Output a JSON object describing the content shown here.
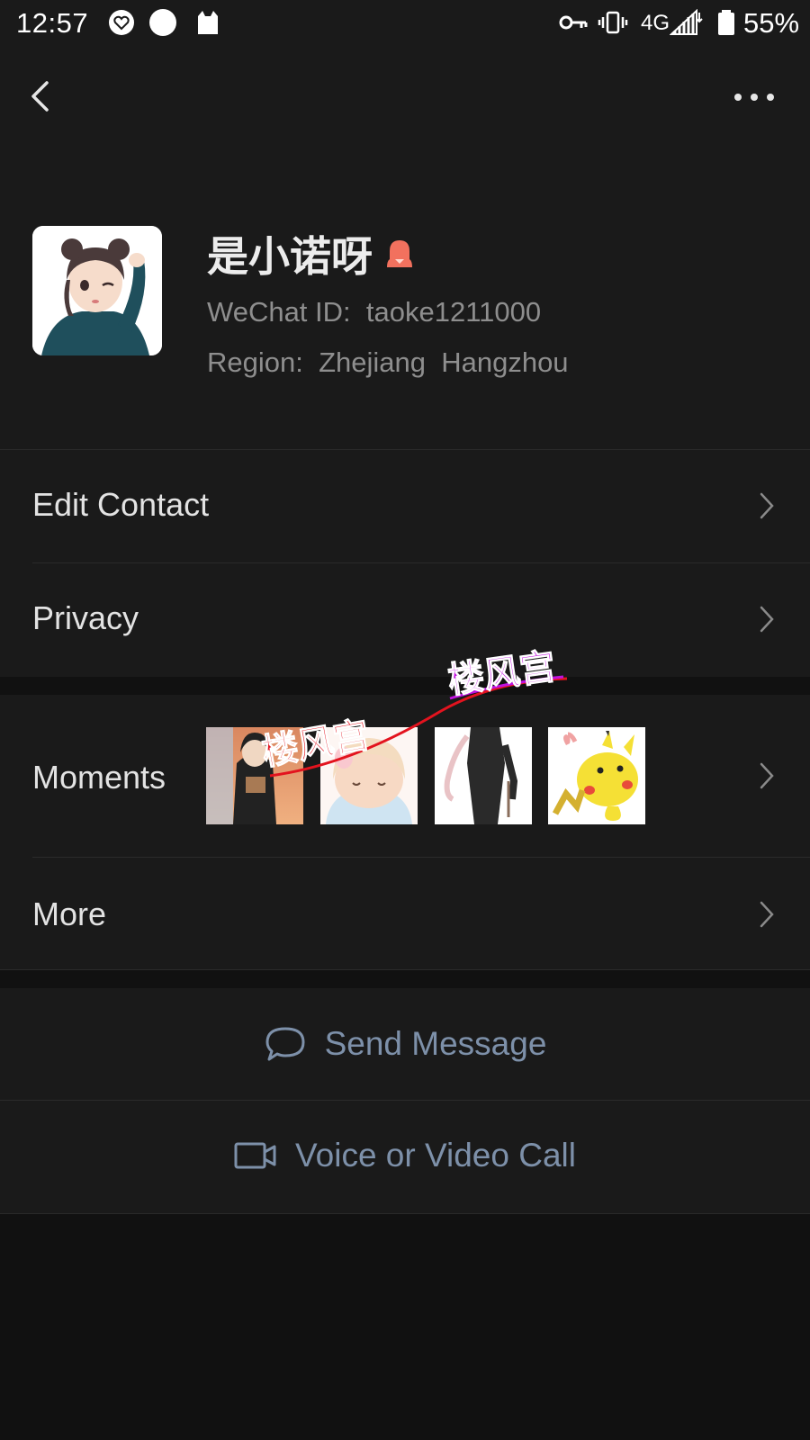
{
  "status_bar": {
    "time": "12:57",
    "network": "4G",
    "battery": "55%",
    "icons": [
      "heart-badge-icon",
      "circle-icon",
      "cat-icon",
      "vpn-key-icon",
      "vibrate-icon",
      "signal-icon",
      "battery-icon"
    ]
  },
  "nav": {
    "back_icon": "back-arrow-icon",
    "more_icon": "more-dots-icon"
  },
  "profile": {
    "nickname": "是小诺呀",
    "gender_icon": "female-icon",
    "wechat_id": "WeChat ID:  taoke1211000",
    "region": "Region:  Zhejiang  Hangzhou"
  },
  "menu": {
    "edit_contact": "Edit Contact",
    "privacy": "Privacy",
    "moments": "Moments",
    "more": "More"
  },
  "moments_thumbnails": [
    "anime-girl-photo",
    "sleeping-chibi-photo",
    "dark-figure-photo",
    "pikachu-photo"
  ],
  "watermark": {
    "text_1": "楼风宫",
    "text_2": "楼风宫"
  },
  "actions": {
    "send_message": "Send Message",
    "voice_video_call": "Voice or Video Call"
  },
  "colors": {
    "background": "#111111",
    "panel": "#1a1a1a",
    "action_text": "#7d90a9",
    "female_icon": "#f2715e",
    "watermark_red": "#e3131e",
    "watermark_purple": "#c012e0"
  }
}
